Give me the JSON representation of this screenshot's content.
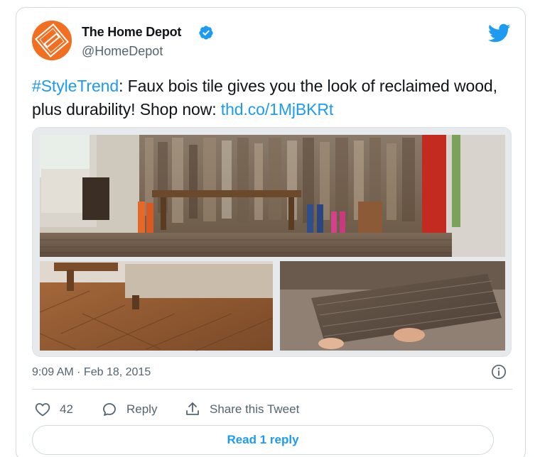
{
  "tweet": {
    "author": {
      "name": "The Home Depot",
      "handle": "@HomeDepot",
      "verified": true,
      "avatar_text": "THE HOME DEPOT",
      "brand_color": "#f26e21"
    },
    "text": {
      "hashtag": "#StyleTrend",
      "body": ": Faux bois tile gives you the look of reclaimed wood, plus durability! Shop now: ",
      "link": "thd.co/1MjBKRt"
    },
    "timestamp": "9:09 AM · Feb 18, 2015",
    "actions": {
      "like_count": "42",
      "reply_label": "Reply",
      "share_label": "Share this Tweet"
    },
    "read_replies_label": "Read 1 reply",
    "icons": [
      "verified-badge-icon",
      "twitter-bird-icon",
      "info-icon",
      "heart-icon",
      "reply-bubble-icon",
      "share-icon"
    ],
    "colors": {
      "accent": "#1d9bf0",
      "text": "#0f1419",
      "secondary": "#536471",
      "border": "#cfd9de"
    }
  }
}
